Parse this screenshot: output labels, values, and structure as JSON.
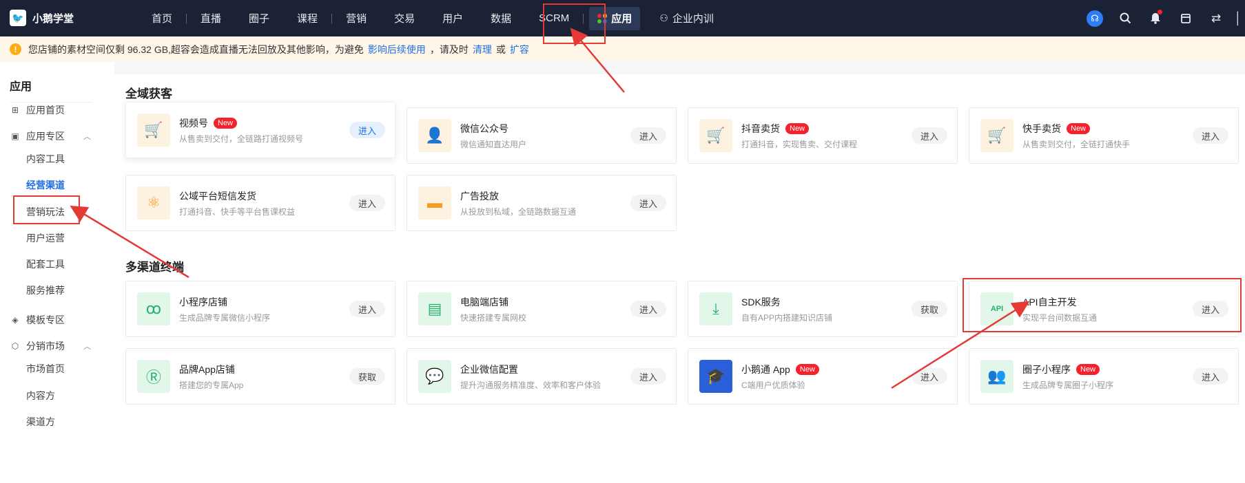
{
  "brand": {
    "logo_icon": "goose-logo-icon",
    "name": "小鹅学堂"
  },
  "nav": {
    "items": [
      {
        "label": "首页"
      },
      {
        "label": "直播"
      },
      {
        "label": "圈子"
      },
      {
        "label": "课程"
      },
      {
        "label": "营销"
      },
      {
        "label": "交易"
      },
      {
        "label": "用户"
      },
      {
        "label": "数据"
      },
      {
        "label": "SCRM"
      },
      {
        "label": "应用"
      },
      {
        "label": "企业内训"
      }
    ],
    "active": "应用",
    "right_icons": [
      "headset-icon",
      "search-icon",
      "bell-icon",
      "store-icon",
      "switch-icon"
    ]
  },
  "notice": {
    "text1": "您店铺的素材空间仅剩 96.32 GB,超容会造成直播无法回放及其他影响，为避免",
    "link1": "影响后续使用",
    "text2": "，请及时",
    "link2": "清理",
    "text3": "或",
    "link3": "扩容"
  },
  "sidebar": {
    "title": "应用",
    "home": "应用首页",
    "group1": "应用专区",
    "group1_items": [
      "内容工具",
      "经营渠道",
      "营销玩法",
      "用户运营",
      "配套工具",
      "服务推荐"
    ],
    "group2": "模板专区",
    "group3": "分销市场",
    "group3_items": [
      "市场首页",
      "内容方",
      "渠道方"
    ]
  },
  "sections": [
    {
      "title": "全域获客",
      "cards": [
        {
          "title": "视频号",
          "desc": "从售卖到交付，全链路打通视频号",
          "btn": "进入",
          "new": "New"
        },
        {
          "title": "微信公众号",
          "desc": "微信通知直达用户",
          "btn": "进入"
        },
        {
          "title": "抖音卖货",
          "desc": "打通抖音，实现售卖、交付课程",
          "btn": "进入",
          "new": "New"
        },
        {
          "title": "快手卖货",
          "desc": "从售卖到交付，全链打通快手",
          "btn": "进入",
          "new": "New"
        },
        {
          "title": "公域平台短信发货",
          "desc": "打通抖音、快手等平台售课权益",
          "btn": "进入"
        },
        {
          "title": "广告投放",
          "desc": "从投放到私域，全链路数据互通",
          "btn": "进入"
        }
      ]
    },
    {
      "title": "多渠道终端",
      "cards": [
        {
          "title": "小程序店铺",
          "desc": "生成品牌专属微信小程序",
          "btn": "进入"
        },
        {
          "title": "电脑端店铺",
          "desc": "快速搭建专属网校",
          "btn": "进入"
        },
        {
          "title": "SDK服务",
          "desc": "自有APP内搭建知识店铺",
          "btn": "获取"
        },
        {
          "title": "API自主开发",
          "desc": "实现平台间数据互通",
          "btn": "进入"
        },
        {
          "title": "品牌App店铺",
          "desc": "搭建您的专属App",
          "btn": "获取"
        },
        {
          "title": "企业微信配置",
          "desc": "提升沟通服务精准度、效率和客户体验",
          "btn": "进入"
        },
        {
          "title": "小鹅通 App",
          "desc": "C端用户优质体验",
          "btn": "进入",
          "new": "New"
        },
        {
          "title": "圈子小程序",
          "desc": "生成品牌专属圈子小程序",
          "btn": "进入",
          "new": "New"
        }
      ]
    }
  ],
  "colors": {
    "nav_bg": "#1b2236",
    "accent": "#1f6fe5",
    "badge": "#f5222d",
    "annotation": "#e53935"
  }
}
